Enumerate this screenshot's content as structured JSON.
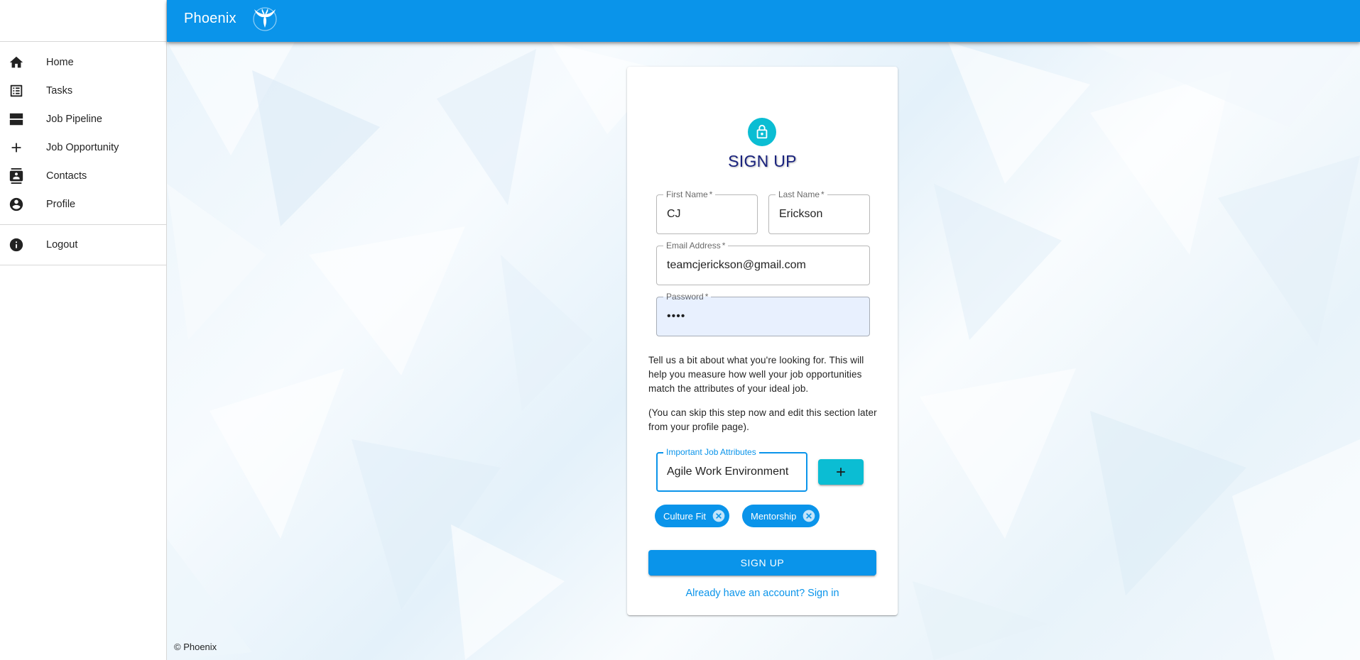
{
  "app": {
    "brand": "Phoenix",
    "footer": "© Phoenix",
    "colors": {
      "primary": "#0a94ea",
      "accent": "#0bbdd3",
      "title": "#1a237e"
    }
  },
  "sidebar": {
    "items": [
      {
        "label": "Home",
        "icon": "home-icon"
      },
      {
        "label": "Tasks",
        "icon": "list-icon"
      },
      {
        "label": "Job Pipeline",
        "icon": "pipeline-icon"
      },
      {
        "label": "Job Opportunity",
        "icon": "add-icon"
      },
      {
        "label": "Contacts",
        "icon": "contacts-icon"
      },
      {
        "label": "Profile",
        "icon": "account-circle-icon"
      }
    ],
    "logout": {
      "label": "Logout",
      "icon": "info-icon"
    }
  },
  "signup": {
    "title": "SIGN UP",
    "first_name": {
      "label": "First Name",
      "required": "*",
      "value": "CJ"
    },
    "last_name": {
      "label": "Last Name",
      "required": "*",
      "value": "Erickson"
    },
    "email": {
      "label": "Email Address",
      "required": "*",
      "value": "teamcjerickson@gmail.com"
    },
    "password": {
      "label": "Password",
      "required": "*",
      "value": "••••"
    },
    "description": "Tell us a bit about what you're looking for. This will help you measure how well your job opportunities match the attributes of your ideal job.",
    "skip_note": "(You can skip this step now and edit this section later from your profile page).",
    "attributes": {
      "label": "Important Job Attributes",
      "value": "Agile Work Environment"
    },
    "chips": [
      {
        "label": "Culture Fit"
      },
      {
        "label": "Mentorship"
      }
    ],
    "submit_label": "SIGN UP",
    "signin_link": "Already have an account? Sign in"
  }
}
